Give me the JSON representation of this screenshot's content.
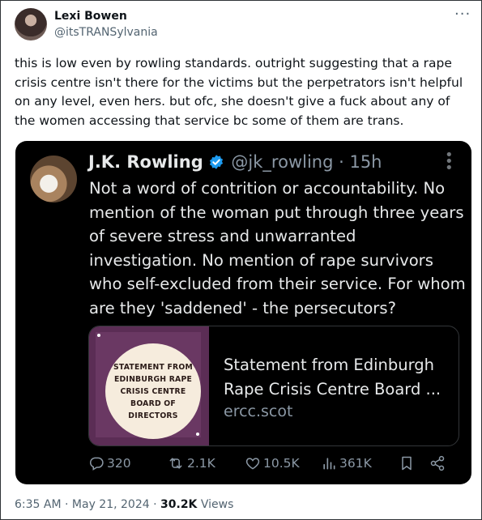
{
  "author": {
    "name": "Lexi Bowen",
    "handle": "@itsTRANSylvania"
  },
  "tweet_text": "this is low even by rowling standards. outright suggesting that a rape crisis centre isn't there for the victims but the perpetrators isn't helpful on any level, even hers. but ofc, she doesn't give a fuck about any of the women accessing that service bc some of them are trans.",
  "quoted": {
    "name": "J.K. Rowling",
    "handle": "@jk_rowling",
    "time": "15h",
    "text": "Not a word of contrition or accountability. No mention of the woman put through three years of severe stress and unwarranted investigation. No mention of rape survivors who self-excluded from their service. For whom are they 'saddened' - the persecutors?",
    "link": {
      "thumb_lines": [
        "STATEMENT FROM",
        "EDINBURGH RAPE",
        "CRISIS CENTRE",
        "BOARD OF DIRECTORS"
      ],
      "title_line1": "Statement from Edinburgh",
      "title_line2": "Rape Crisis Centre Board ...",
      "domain": "ercc.scot"
    },
    "stats": {
      "replies": "320",
      "reposts": "2.1K",
      "likes": "10.5K",
      "views": "361K"
    },
    "colors": {
      "verified": "#1d9bf0",
      "background": "#000000"
    }
  },
  "footer": {
    "time": "6:35 AM",
    "date": "May 21, 2024",
    "views_count": "30.2K",
    "views_label": "Views"
  }
}
